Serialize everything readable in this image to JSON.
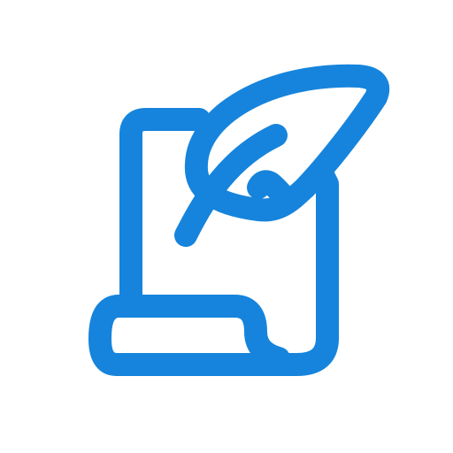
{
  "icon": {
    "name": "scroll-with-quill-icon",
    "stroke_color": "#1684DC",
    "background_color": "#FFFFFF"
  }
}
